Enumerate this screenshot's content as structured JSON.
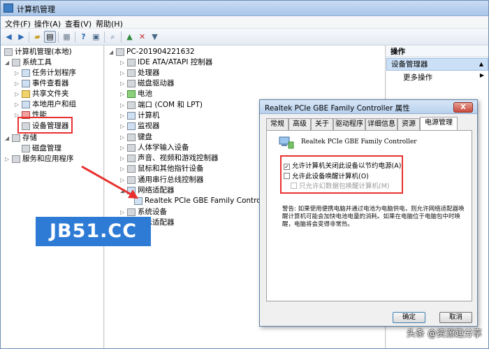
{
  "window": {
    "title": "计算机管理"
  },
  "menu": [
    "文件(F)",
    "操作(A)",
    "查看(V)",
    "帮助(H)"
  ],
  "toolbar_icons": [
    "back-arrow-icon",
    "forward-arrow-icon",
    "up-folder-icon",
    "show-tree-icon",
    "export-icon",
    "help-icon",
    "properties-icon",
    "scan-hardware-icon",
    "update-driver-icon",
    "uninstall-icon",
    "disable-device-icon"
  ],
  "left_tree": {
    "root": "计算机管理(本地)",
    "system_tools": "系统工具",
    "task_scheduler": "任务计划程序",
    "event_viewer": "事件查看器",
    "shared_folders": "共享文件夹",
    "local_users": "本地用户和组",
    "performance": "性能",
    "device_manager": "设备管理器",
    "storage": "存储",
    "disk_management": "磁盘管理",
    "services": "服务和应用程序"
  },
  "device_tree": {
    "computer": "PC-201904221632",
    "items": [
      "IDE ATA/ATAPI 控制器",
      "处理器",
      "磁盘驱动器",
      "电池",
      "端口 (COM 和 LPT)",
      "计算机",
      "监视器",
      "键盘",
      "人体学输入设备",
      "声音、视频和游戏控制器",
      "鼠标和其他指针设备",
      "通用串行总线控制器",
      "网络适配器"
    ],
    "network_child": "Realtek PCIe GBE Family Controller",
    "after": [
      "系统设备",
      "显示适配器"
    ]
  },
  "actions": {
    "header": "操作",
    "selected": "设备管理器",
    "more": "更多操作"
  },
  "banner": "JB51.CC",
  "dialog": {
    "title": "Realtek PCIe GBE Family Controller 属性",
    "close": "X",
    "tabs": [
      "常规",
      "高级",
      "关于",
      "驱动程序",
      "详细信息",
      "资源",
      "电源管理"
    ],
    "active_tab": 6,
    "device_name": "Realtek PCIe GBE Family Controller",
    "checkbox1": "允许计算机关闭此设备以节约电源(A)",
    "checkbox1_checked": true,
    "checkbox2": "允许此设备唤醒计算机(O)",
    "checkbox2_checked": false,
    "checkbox3": "只允许幻数据包唤醒计算机(M)",
    "checkbox3_checked": false,
    "warning": "警告: 如果使用便携电脑并通过电池为电脑供电，则允许网络适配器唤醒计算机可能会加快电池电量的消耗。如果在电脑位于电脑包中时唤醒，电脑将会变得非常热。",
    "ok": "确定",
    "cancel": "取消"
  },
  "watermark": "头条 @资源趣分享",
  "colors": {
    "highlight_red": "#e8312f",
    "banner_blue": "#2e7bd6"
  }
}
